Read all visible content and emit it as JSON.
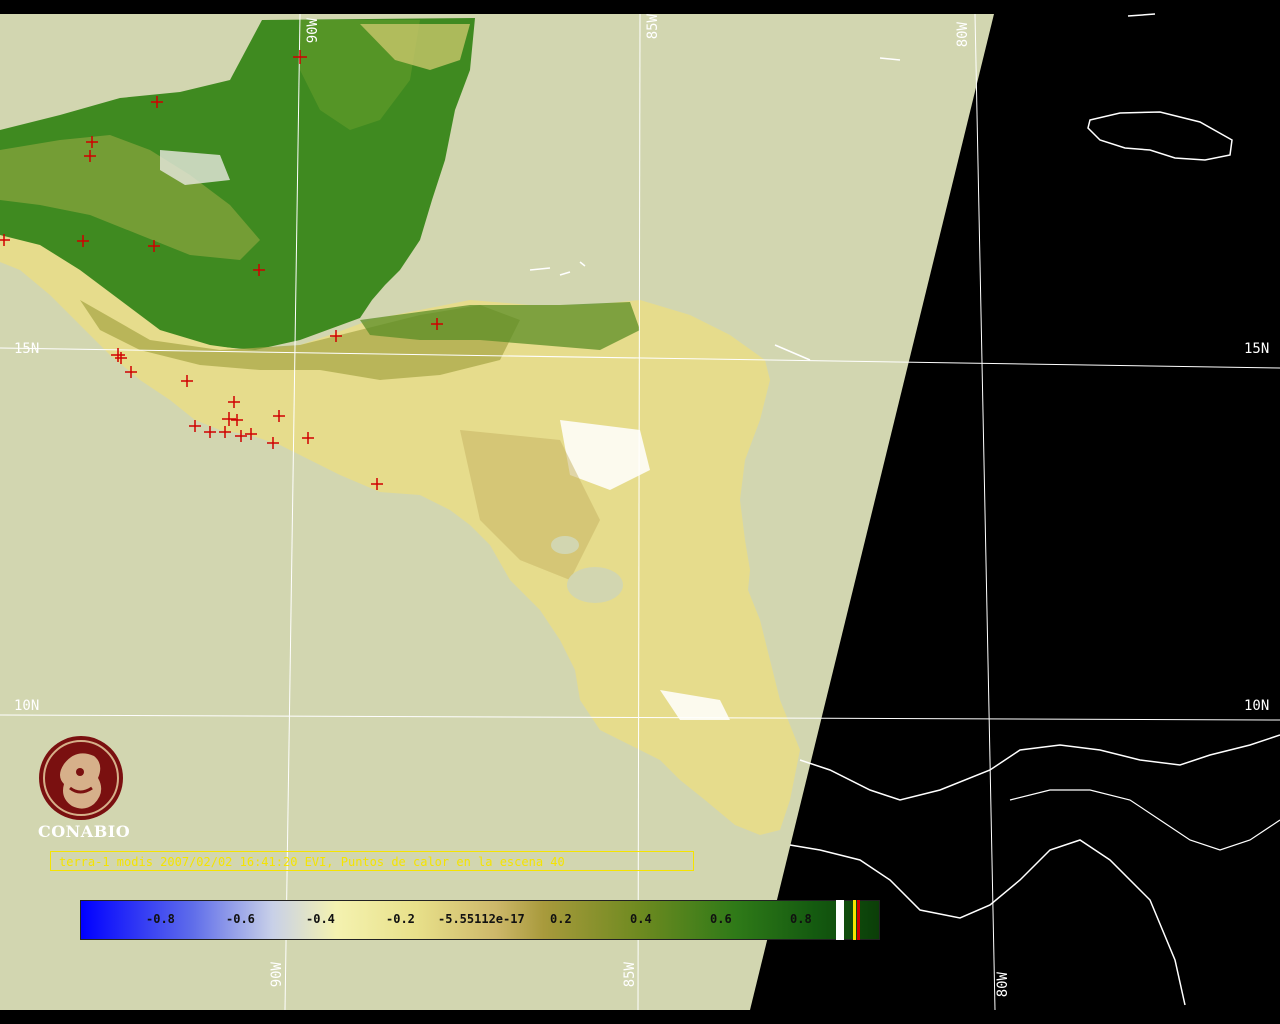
{
  "map": {
    "grid_labels": {
      "lat_15_left": "15N",
      "lat_15_right": "15N",
      "lat_10_left": "10N",
      "lat_10_right": "10N",
      "lon_90_top": "90W",
      "lon_85_top": "85W",
      "lon_80_top": "80W",
      "lon_90_bottom": "90W",
      "lon_85_bottom": "85W",
      "lon_80_bottom": "80W"
    },
    "colors": {
      "background_swath": "#d2d6b0",
      "outside_swath": "#000000",
      "vegetation_high": "#2f7a18",
      "vegetation_low": "#e8e08a",
      "hotspot": "#d00000",
      "grid": "#ffffff",
      "caption": "#f5e400"
    }
  },
  "logo": {
    "name": "CONABIO"
  },
  "caption": {
    "text": "terra-1 modis 2007/02/02 16:41:20 EVI, Puntos de calor en la escena 40"
  },
  "colorbar": {
    "labels": [
      "-0.8",
      "-0.6",
      "-0.4",
      "-0.2",
      "-5.55112e-17",
      "0.2",
      "0.4",
      "0.6",
      "0.8"
    ]
  }
}
